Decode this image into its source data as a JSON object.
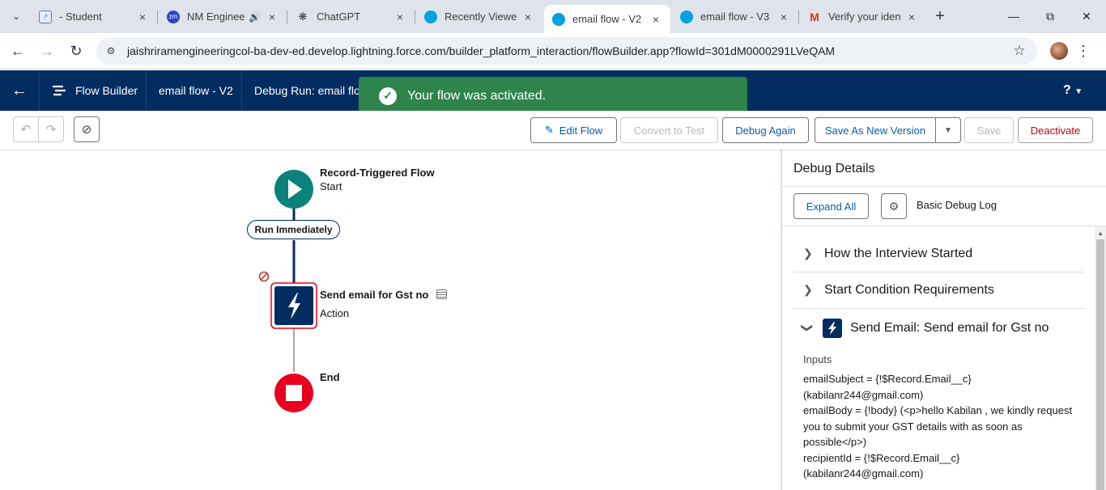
{
  "browser": {
    "tabs": [
      {
        "title": "- Student",
        "icon": "student-icon"
      },
      {
        "title": "NM Engineering",
        "icon": "zoom-icon"
      },
      {
        "title": "ChatGPT",
        "icon": "chatgpt-icon"
      },
      {
        "title": "Recently Viewed",
        "icon": "salesforce-icon"
      },
      {
        "title": "email flow - V2",
        "icon": "salesforce-icon"
      },
      {
        "title": "email flow - V3",
        "icon": "salesforce-icon"
      },
      {
        "title": "Verify your identity",
        "icon": "gmail-icon"
      }
    ],
    "url": "jaishriramengineeringcol-ba-dev-ed.develop.lightning.force.com/builder_platform_interaction/flowBuilder.app?flowId=301dM0000291LVeQAM"
  },
  "header": {
    "app_name": "Flow Builder",
    "flow_title": "email flow - V2",
    "debug_title": "Debug Run: email flow",
    "help": "?"
  },
  "toast": {
    "message": "Your flow was activated."
  },
  "toolbar": {
    "edit_flow": "Edit Flow",
    "convert_to_test": "Convert to Test",
    "debug_again": "Debug Again",
    "save_as_new_version": "Save As New Version",
    "save": "Save",
    "deactivate": "Deactivate"
  },
  "canvas": {
    "start": {
      "title": "Record-Triggered Flow",
      "subtitle": "Start"
    },
    "path_label": "Run Immediately",
    "action": {
      "title": "Send email for Gst no",
      "subtitle": "Action"
    },
    "end": {
      "title": "End"
    },
    "colors": {
      "start": "#0b827c",
      "action": "#032d60",
      "end": "#ea001e"
    }
  },
  "debug_panel": {
    "title": "Debug Details",
    "expand_all": "Expand All",
    "log_label": "Basic Debug Log",
    "sections": [
      {
        "title": "How the Interview Started",
        "expanded": false
      },
      {
        "title": "Start Condition Requirements",
        "expanded": false
      },
      {
        "title": "Send Email: Send email for Gst no",
        "expanded": true
      }
    ],
    "inputs_label": "Inputs",
    "inputs_lines": [
      "emailSubject = {!$Record.Email__c}",
      "(kabilanr244@gmail.com)",
      "emailBody = {!body} (<p>hello Kabilan , we kindly request you to submit your GST details with as soon as possible</p>)",
      "recipientId = {!$Record.Email__c}",
      "(kabilanr244@gmail.com)"
    ]
  }
}
